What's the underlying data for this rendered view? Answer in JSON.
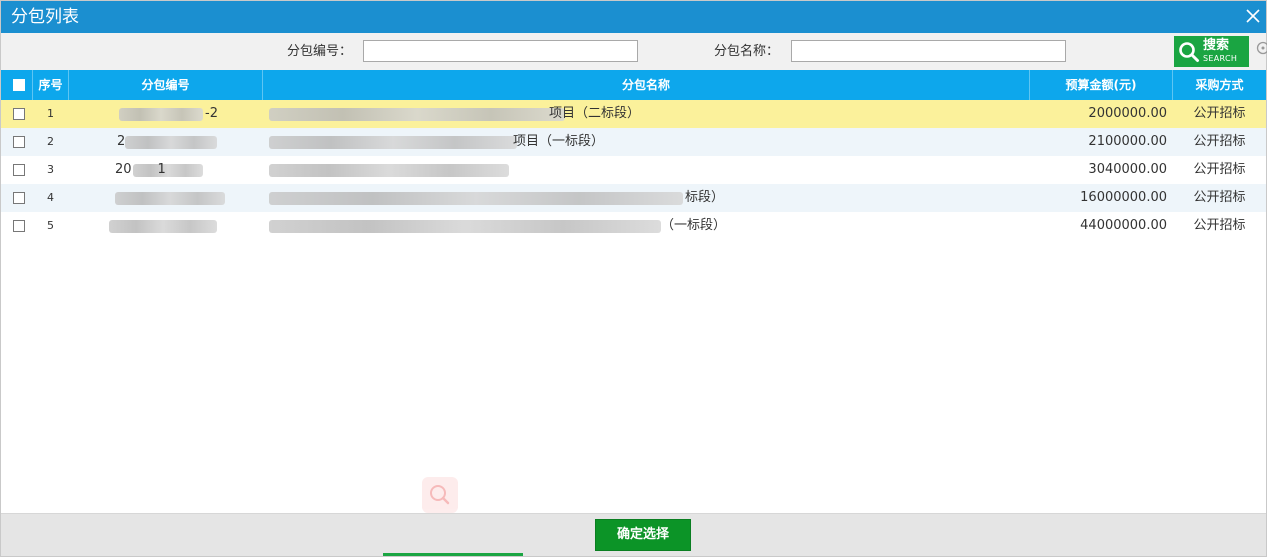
{
  "window": {
    "title": "分包列表"
  },
  "search": {
    "code_label": "分包编号：",
    "code_value": "",
    "name_label": "分包名称：",
    "name_value": "",
    "button_label": "搜索",
    "button_sub": "SEARCH"
  },
  "table": {
    "columns": [
      "序号",
      "分包编号",
      "分包名称",
      "预算金额(元)",
      "采购方式"
    ],
    "rows": [
      {
        "index": "1",
        "code_visible": "-2",
        "name_visible": "项目（二标段）",
        "amount": "2000000.00",
        "method": "公开招标",
        "selected": true
      },
      {
        "index": "2",
        "code_visible": "2",
        "name_visible": "项目（一标段）",
        "amount": "2100000.00",
        "method": "公开招标",
        "selected": false
      },
      {
        "index": "3",
        "code_visible": "20　　1",
        "name_visible": "",
        "amount": "3040000.00",
        "method": "公开招标",
        "selected": false
      },
      {
        "index": "4",
        "code_visible": "",
        "name_visible": "标段）",
        "amount": "16000000.00",
        "method": "公开招标",
        "selected": false
      },
      {
        "index": "5",
        "code_visible": "",
        "name_visible": "（一标段）",
        "amount": "44000000.00",
        "method": "公开招标",
        "selected": false
      }
    ]
  },
  "footer": {
    "confirm_label": "确定选择"
  },
  "colors": {
    "titlebar": "#1b8fd0",
    "header": "#0da7ec",
    "selected_row": "#fbf19b",
    "alt_row": "#eef5fa",
    "button_green": "#0c9427"
  },
  "icons": {
    "close": "close-icon",
    "search": "search-icon",
    "refresh": "refresh-icon"
  }
}
